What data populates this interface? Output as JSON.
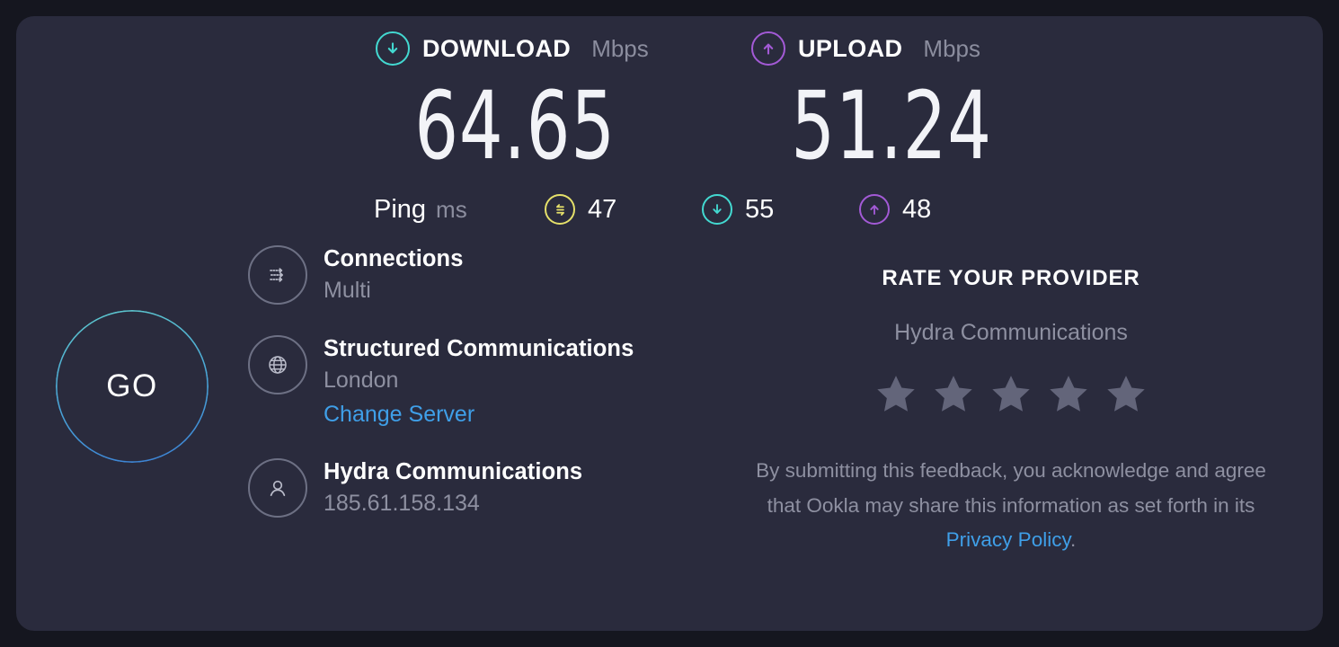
{
  "theme": {
    "page_bg": "#15161f",
    "card_bg": "#2a2b3d",
    "download_accent": "#43d9d1",
    "upload_accent": "#a35ad6",
    "idle_accent": "#e5e06a",
    "link_color": "#3f9fe8",
    "muted_text": "#8e90a1",
    "star_color": "#63657a"
  },
  "results": {
    "download": {
      "icon": "download-arrow-icon",
      "label": "DOWNLOAD",
      "unit": "Mbps",
      "value": "64.65"
    },
    "upload": {
      "icon": "upload-arrow-icon",
      "label": "UPLOAD",
      "unit": "Mbps",
      "value": "51.24"
    }
  },
  "ping": {
    "label": "Ping",
    "unit": "ms",
    "idle": {
      "icon": "bidirectional-arrows-icon",
      "value": "47"
    },
    "download": {
      "icon": "download-arrow-icon",
      "value": "55"
    },
    "upload": {
      "icon": "upload-arrow-icon",
      "value": "48"
    }
  },
  "go_button": {
    "label": "GO"
  },
  "connection_info": {
    "connections": {
      "icon": "multi-connection-icon",
      "title": "Connections",
      "detail": "Multi"
    },
    "server": {
      "icon": "globe-icon",
      "title": "Structured Communications",
      "detail": "London",
      "change_link": "Change Server"
    },
    "isp": {
      "icon": "person-icon",
      "title": "Hydra Communications",
      "detail": "185.61.158.134"
    }
  },
  "rate_provider": {
    "heading": "RATE YOUR PROVIDER",
    "provider_name": "Hydra Communications",
    "star_count": 5,
    "stars_filled": 0,
    "disclaimer_before": "By submitting this feedback, you acknowledge and agree that Ookla may share this information as set forth in its ",
    "disclaimer_link": "Privacy Policy",
    "disclaimer_after": "."
  }
}
